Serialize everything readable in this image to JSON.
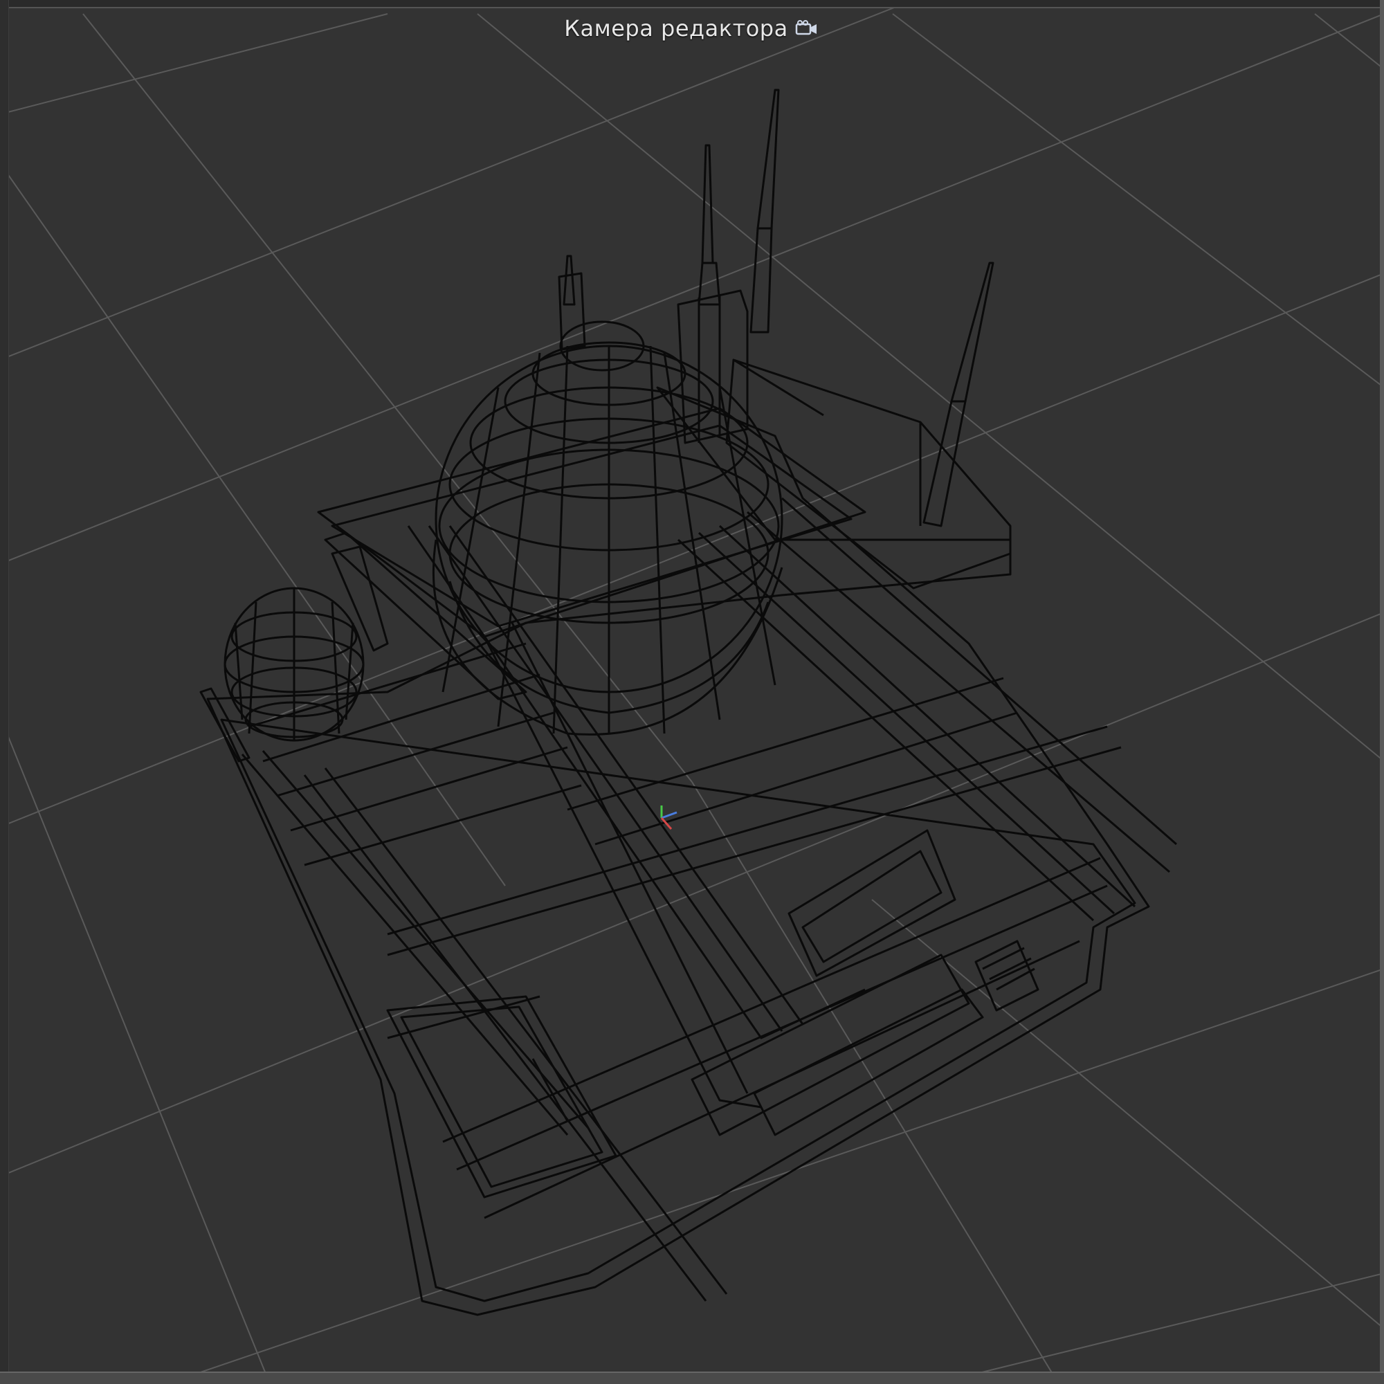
{
  "viewport": {
    "camera_label": "Камера редактора",
    "camera_icon": "video-camera-icon",
    "background_color": "#333333",
    "grid_color": "#5a5a5a",
    "wireframe_color": "#0a0a0a"
  },
  "gizmo": {
    "x_axis_color": "#d84848",
    "y_axis_color": "#48c848",
    "z_axis_color": "#4a7ee0"
  }
}
